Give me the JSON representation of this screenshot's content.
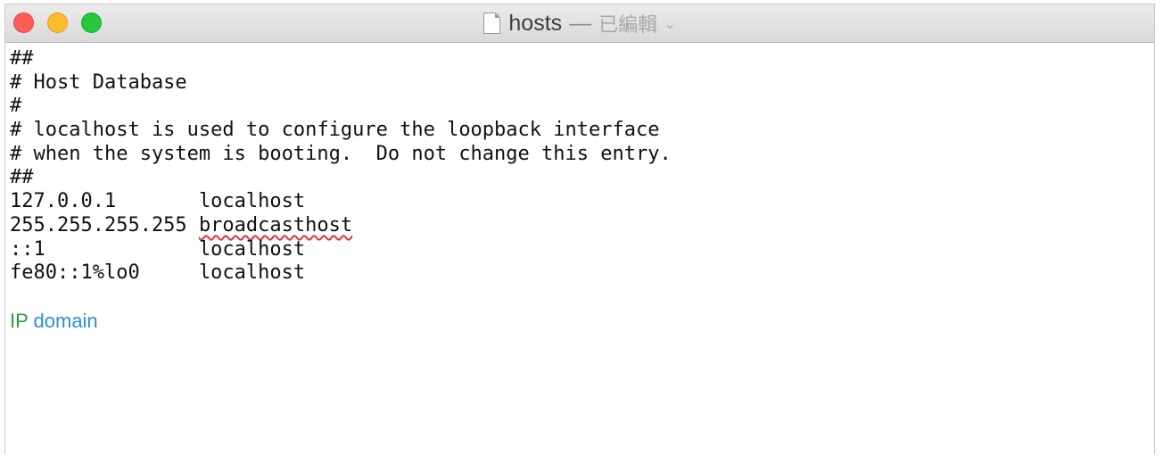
{
  "window": {
    "title": "hosts",
    "separator": "—",
    "status": "已編輯",
    "icons": {
      "document": "document-icon",
      "chevron": "chevron-down-icon"
    }
  },
  "colors": {
    "close": "#fc5f57",
    "minimize": "#fdbc2e",
    "zoom": "#27c840",
    "ip_label": "#2f9a3a",
    "domain_label": "#2b8fd0",
    "spellcheck": "#e0343c"
  },
  "content": {
    "comments": [
      "##",
      "# Host Database",
      "#",
      "# localhost is used to configure the loopback interface",
      "# when the system is booting.  Do not change this entry.",
      "##"
    ],
    "entries": [
      {
        "ip": "127.0.0.1",
        "pad": "       ",
        "host": "localhost"
      },
      {
        "ip": "255.255.255.255",
        "pad": " ",
        "host": "broadcasthost"
      },
      {
        "ip": "::1",
        "pad": "             ",
        "host": "localhost"
      },
      {
        "ip": "fe80::1%lo0",
        "pad": "     ",
        "host": "localhost"
      }
    ],
    "annotation": {
      "ip": "IP",
      "domain": "domain"
    }
  }
}
